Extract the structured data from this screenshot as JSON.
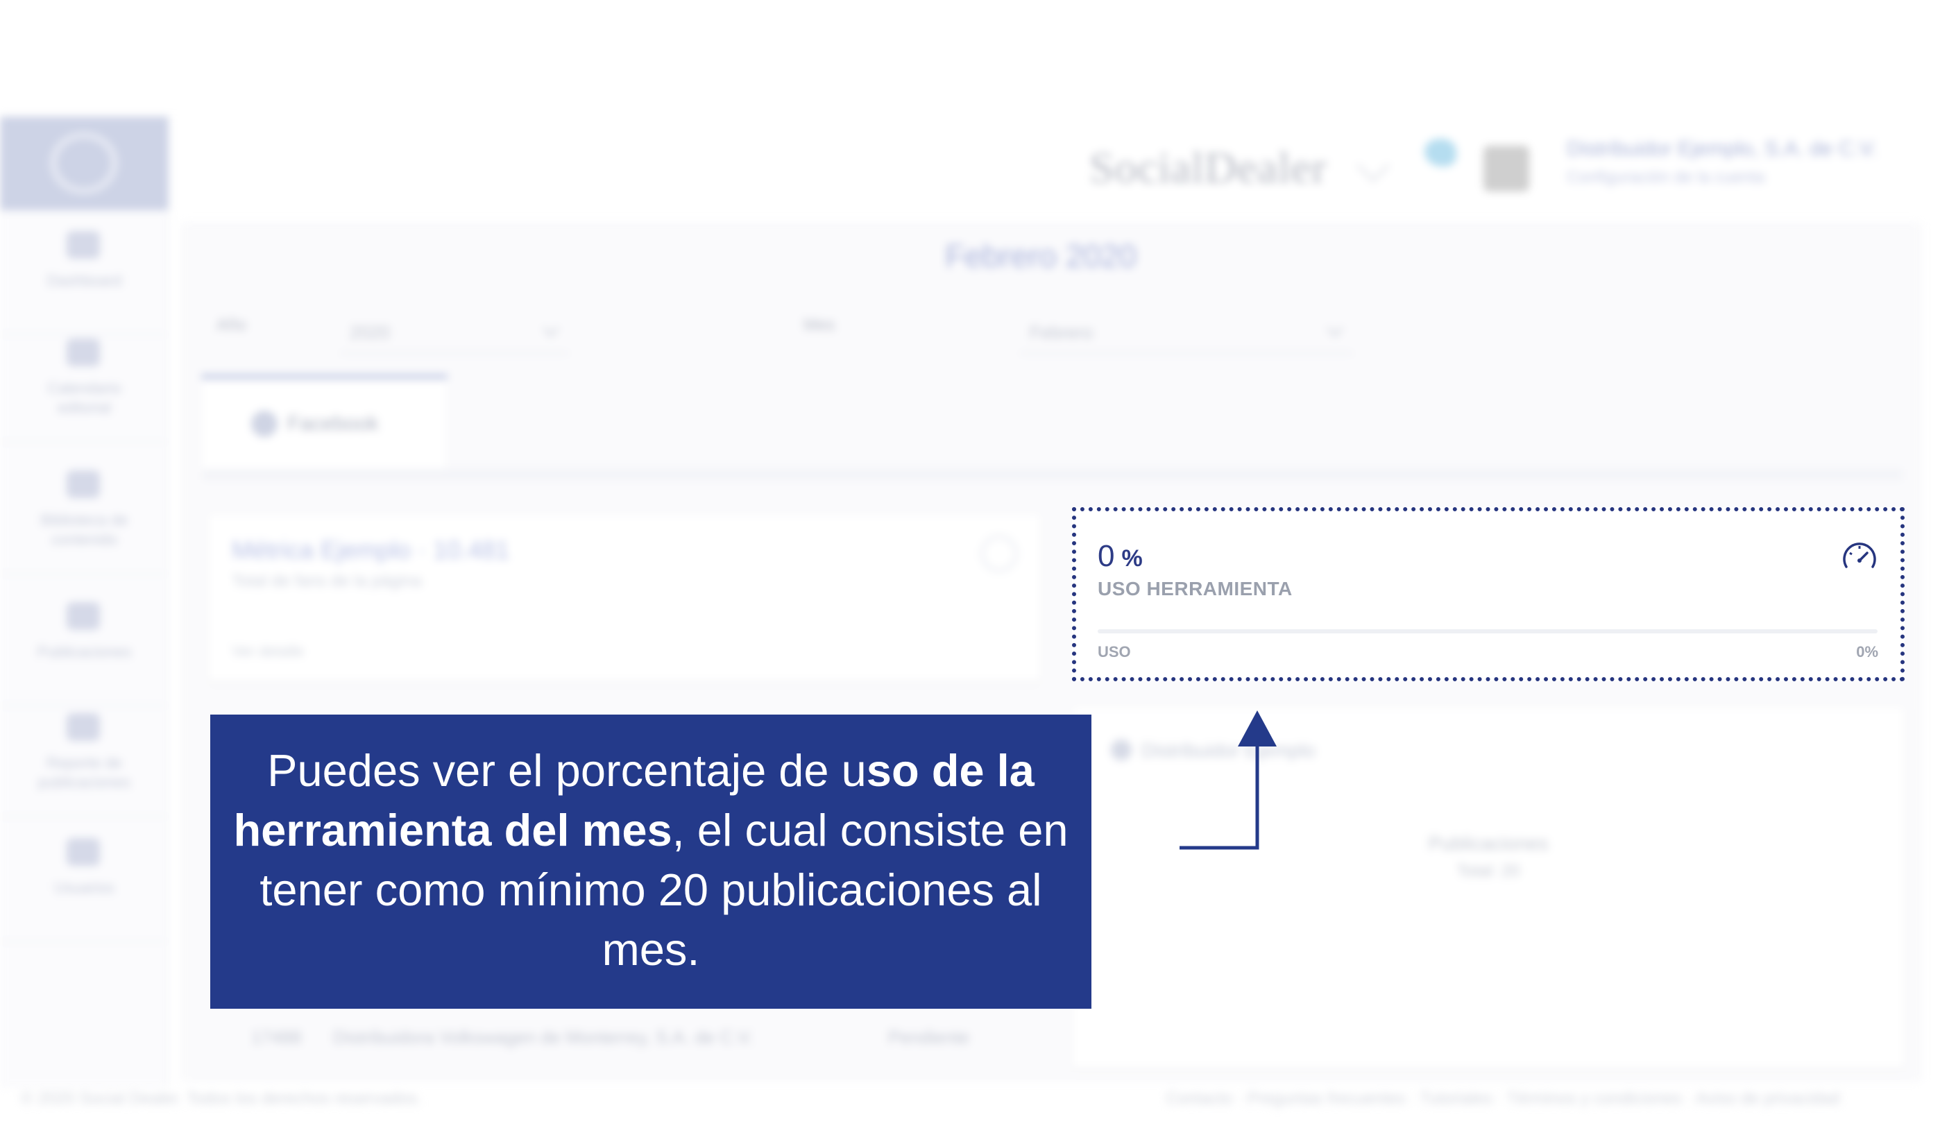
{
  "app": {
    "brand": "SocialDealer",
    "user_name": "Distribuidor Ejemplo, S.A. de C.V.",
    "user_role": "Configuración de la cuenta"
  },
  "sidebar": {
    "items": [
      {
        "label": "Dashboard",
        "icon": "dashboard-icon"
      },
      {
        "label": "Calendario editorial",
        "icon": "calendar-icon"
      },
      {
        "label": "Biblioteca de contenido",
        "icon": "library-icon"
      },
      {
        "label": "Publicaciones",
        "icon": "posts-icon"
      },
      {
        "label": "Reporte de publicaciones",
        "icon": "report-icon"
      },
      {
        "label": "Usuarios",
        "icon": "users-icon"
      }
    ]
  },
  "filters": {
    "title": "Febrero 2020",
    "year_label": "Año",
    "year_value": "2020",
    "month_label": "Mes",
    "month_value": "Febrero"
  },
  "tabs": {
    "facebook": "Facebook"
  },
  "left_card": {
    "title": "Métrica Ejemplo · 10.481",
    "subtitle": "Total de fans de la página",
    "footer": "Ver detalle"
  },
  "usage_widget": {
    "value": "0",
    "unit": "%",
    "label": "USO HERRAMIENTA",
    "footer_left": "USO",
    "footer_right": "0%",
    "progress": 0,
    "accent_color": "#26357f"
  },
  "accounts_card": {
    "name": "Distribuidor Ejemplo",
    "center_title": "Publicaciones",
    "center_sub": "Total: 20"
  },
  "list_row": {
    "id": "17488",
    "name": "Distribuidora Volkswagen de Monterrey, S.A. de C.V.",
    "status": "Pendiente"
  },
  "footer": {
    "left": "© 2020 Social Dealer. Todos los derechos reservados.",
    "links": "Contacto · Preguntas frecuentes · Tutoriales · Términos y condiciones · Aviso de privacidad"
  },
  "callout": {
    "text_1": "Puedes ver el porcentaje de u",
    "text_bold": "so de la herramienta del mes",
    "text_2": ", el cual consiste en tener como mínimo 20 publicaciones al mes."
  }
}
